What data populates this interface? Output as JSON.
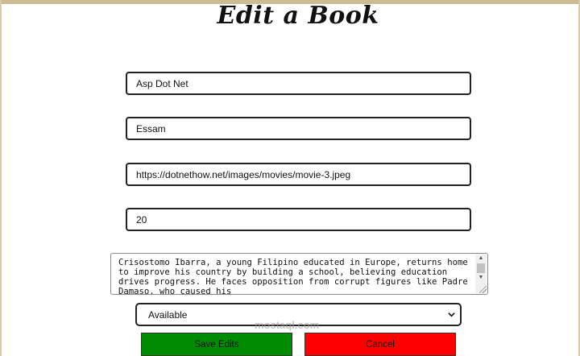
{
  "page": {
    "title": "Edit a Book"
  },
  "form": {
    "title_value": "Asp Dot Net",
    "author_value": "Essam",
    "image_url_value": "https://dotnethow.net/images/movies/movie-3.jpeg",
    "quantity_value": "20",
    "description_value": "Crisostomo Ibarra, a young Filipino educated in Europe, returns home to improve his country by building a school, believing education drives progress. He faces opposition from corrupt figures like Padre Damaso, who caused his",
    "status_selected": "Available"
  },
  "buttons": {
    "save_label": "Save Edits",
    "cancel_label": "Cancel"
  },
  "colors": {
    "save": "#008c00",
    "cancel": "#ff0000",
    "frame": "#cdbb93"
  },
  "watermark": {
    "text": "mostaql.com"
  }
}
